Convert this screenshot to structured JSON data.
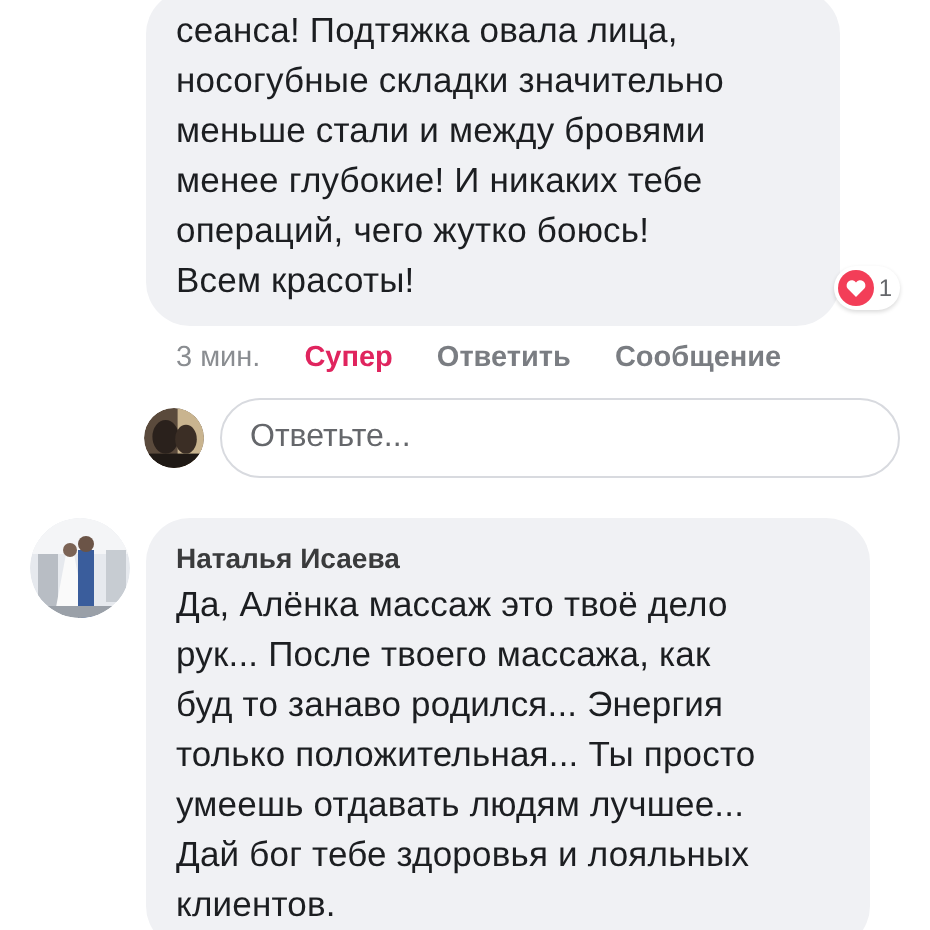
{
  "comments": [
    {
      "text": "сеанса! Подтяжка овала лица,\nносогубные складки значительно\nменьше стали и между бровями\nменее глубокие! И никаких тебе\nопераций, чего жутко боюсь!\nВсем красоты!",
      "reaction_count": "1",
      "time": "3 мин.",
      "actions": [
        {
          "kind": "reaction",
          "label": "Супер",
          "selected": true
        },
        {
          "kind": "link",
          "label": "Ответить"
        },
        {
          "kind": "link",
          "label": "Сообщение"
        }
      ],
      "reply": {
        "placeholder": "Ответьте..."
      }
    },
    {
      "author": "Наталья Исаева",
      "text": "Да, Алёнка массаж это твоё дело\nрук... После твоего массажа, как\nбуд то занаво родился... Энергия\nтолько положительная... Ты просто\nумеешь отдавать людям лучшее...\nДай бог тебе здоровья и лояльных\nклиентов."
    }
  ]
}
